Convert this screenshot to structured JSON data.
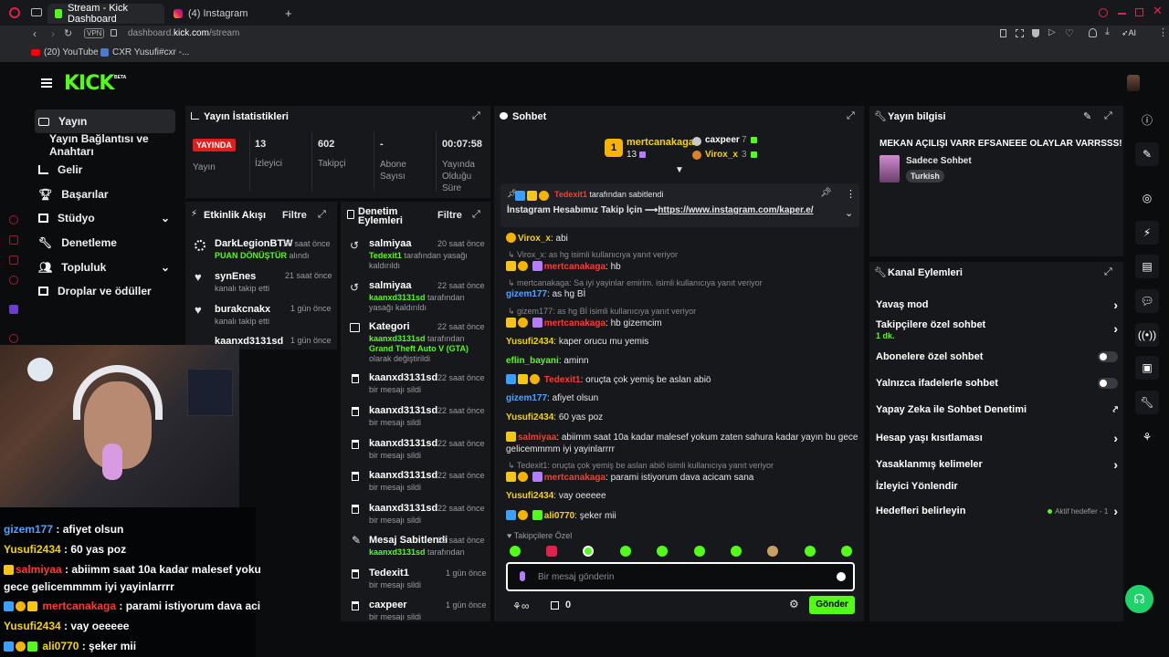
{
  "browser": {
    "tabs": [
      {
        "label": "Stream - Kick Dashboard",
        "active": true
      },
      {
        "label": "(4) Instagram",
        "active": false
      }
    ],
    "new_tab": "+",
    "url_domain_prefix": "dashboard.",
    "url_domain": "kick.com",
    "url_path": "/stream",
    "vpn_label": "VPN",
    "ai_label": "AI",
    "bookmarks": [
      "(20) YouTube",
      "CXR Yusufi#cxr -..."
    ]
  },
  "brand": {
    "logo": "KICK",
    "beta": "BETA",
    "accent": "#53fc18"
  },
  "nav": {
    "items": [
      {
        "label": "Yayın",
        "icon": "video-icon"
      },
      {
        "label": "Yayın Bağlantısı ve Anahtarı",
        "icon": ""
      },
      {
        "label": "Gelir",
        "icon": "chart-icon"
      },
      {
        "label": "Başarılar",
        "icon": "trophy-icon"
      },
      {
        "label": "Stüdyo",
        "icon": "studio-icon"
      },
      {
        "label": "Denetleme",
        "icon": "wrench-icon"
      },
      {
        "label": "Topluluk",
        "icon": "people-icon"
      },
      {
        "label": "Droplar ve ödüller",
        "icon": "gift-icon"
      }
    ]
  },
  "stats": {
    "title": "Yayın İstatistikleri",
    "live_badge": "YAYINDA",
    "live_label": "Yayın",
    "viewers_value": "13",
    "viewers_label": "İzleyici",
    "followers_value": "602",
    "followers_label": "Takipçi",
    "subs_value": "-",
    "subs_label": "Abone Sayısı",
    "uptime_value": "00:07:58",
    "uptime_label": "Yayında Olduğu Süre"
  },
  "activity": {
    "title": "Etkinlik Akışı",
    "filter": "Filtre",
    "items": [
      {
        "name": "DarkLegionBTW",
        "time": "20 saat önce",
        "sub": "PUAN DÖNÜŞTÜR",
        "sub2": " alındı"
      },
      {
        "name": "synEnes",
        "time": "21 saat önce",
        "sub": "kanalı takip etti",
        "sub2": ""
      },
      {
        "name": "burakcnakx",
        "time": "1 gün önce",
        "sub": "kanalı takip etti",
        "sub2": ""
      },
      {
        "name": "kaanxd3131sd",
        "time": "1 gün önce",
        "sub": "kanalı takip etti",
        "sub2": ""
      }
    ]
  },
  "modlog": {
    "title_line1": "Denetim",
    "title_line2": "Eylemleri",
    "filter": "Filtre",
    "items": [
      {
        "name": "salmiyaa",
        "time": "20 saat önce",
        "who": "Tedexit1",
        "text": " tarafından yasağı kaldırıldı"
      },
      {
        "name": "salmiyaa",
        "time": "22 saat önce",
        "who": "kaanxd3131sd",
        "text": " tarafından yasağı kaldırıldı"
      },
      {
        "name": "Kategori",
        "time": "22 saat önce",
        "who": "kaanxd3131sd",
        "text": " tarafından ",
        "extra": "Grand Theft Auto V (GTA)",
        "text2": " olarak değiştirildi"
      },
      {
        "name": "kaanxd3131sd",
        "time": "22 saat önce",
        "text": "bir mesajı sildi"
      },
      {
        "name": "kaanxd3131sd",
        "time": "22 saat önce",
        "text": "bir mesajı sildi"
      },
      {
        "name": "kaanxd3131sd",
        "time": "22 saat önce",
        "text": "bir mesajı sildi"
      },
      {
        "name": "kaanxd3131sd",
        "time": "22 saat önce",
        "text": "bir mesajı sildi"
      },
      {
        "name": "kaanxd3131sd",
        "time": "22 saat önce",
        "text": "bir mesajı sildi"
      },
      {
        "name": "Mesaj Sabitlendi",
        "time": "22 saat önce",
        "who": "kaanxd3131sd",
        "text": " tarafından"
      },
      {
        "name": "Tedexit1",
        "time": "1 gün önce",
        "text": "bir mesajı sildi"
      },
      {
        "name": "caxpeer",
        "time": "1 gün önce",
        "text": "bir mesajı sildi"
      }
    ]
  },
  "chat": {
    "title": "Sohbet",
    "leaderboard": {
      "first_name": "mertcanakaga",
      "first_value": "13",
      "second_name": "caxpeer",
      "second_value": "7",
      "third_name": "Virox_x",
      "third_value": "3"
    },
    "pinned_by": "Tedexit1",
    "pinned_by_suffix": " tarafından sabitlendi",
    "pinned_text": "İnstagram Hesabımız Takip İçin ⟶",
    "pinned_link": "https://www.instagram.com/kaper.e/",
    "messages": [
      {
        "user": "Virox_x",
        "text": ": abi"
      },
      {
        "reply": "Virox_x: as hg isimli kullanıcıya yanıt veriyor"
      },
      {
        "user": "mertcanakaga",
        "text": ": hb"
      },
      {
        "reply": "mertcanakaga: Sa iyi yayinlar emirim. isimli kullanıcıya yanıt veriyor"
      },
      {
        "user": "gizem177",
        "text": ": as hg Bİ"
      },
      {
        "reply": "gizem177: as hg Bİ isimli kullanıcıya yanıt veriyor"
      },
      {
        "user": "mertcanakaga",
        "text": ": hb gizemcim"
      },
      {
        "user": "Yusufi2434",
        "text": ": kaper orucu mu yemis"
      },
      {
        "user": "eflin_bayani",
        "text": ": aminn"
      },
      {
        "user": "Tedexit1",
        "text": ": oruçta çok yemiş be aslan abiö"
      },
      {
        "user": "gizem177",
        "text": ": afiyet olsun"
      },
      {
        "user": "Yusufi2434",
        "text": ": 60 yas poz"
      },
      {
        "user": "salmiyaa",
        "text": ": abiimm saat 10a kadar malesef yokum zaten sahura kadar yayın bu gece"
      },
      {
        "cont": "gelicemmmm iyi yayinlarrrr"
      },
      {
        "reply": "Tedexit1: oruçta çok yemiş be aslan abiö isimli kullanıcıya yanıt veriyor"
      },
      {
        "user": "mertcanakaga",
        "text": ": parami istiyorum dava acicam sana"
      },
      {
        "user": "Yusufi2434",
        "text": ": vay oeeeee"
      },
      {
        "user": "ali0770",
        "text": ": şeker mii"
      }
    ],
    "followers_only": "Takipçilere Özel",
    "input_placeholder": "Bir mesaj gönderin",
    "infinity": "∞",
    "points": "0",
    "send": "Gönder"
  },
  "stream_info": {
    "title": "Yayın bilgisi",
    "stream_title": "MEKAN AÇILIŞI VARR EFSANEEE OLAYLAR VARRSSS!",
    "category": "Sadece Sohbet",
    "tag": "Turkish"
  },
  "channel_actions": {
    "title": "Kanal Eylemleri",
    "rows": [
      {
        "label": "Yavaş mod",
        "control": "chevron"
      },
      {
        "label": "Takipçilere özel sohbet",
        "sub": "1 dk.",
        "control": "chevron"
      },
      {
        "label": "Abonelere özel sohbet",
        "control": "toggle"
      },
      {
        "label": "Yalnızca ifadelerle sohbet",
        "control": "toggle"
      },
      {
        "label": "Yapay Zeka ile Sohbet Denetimi",
        "control": "external"
      },
      {
        "label": "Hesap yaşı kısıtlaması",
        "control": "chevron"
      },
      {
        "label": "Yasaklanmış kelimeler",
        "control": "chevron"
      },
      {
        "label": "İzleyici Yönlendir",
        "control": "none"
      },
      {
        "label": "Hedefleri belirleyin",
        "control": "chevron",
        "status": "Aktif hedefler - 1"
      }
    ]
  },
  "webcam_chat": [
    {
      "user": "gizem177",
      "text": " : afiyet olsun"
    },
    {
      "user": "Yusufi2434",
      "text": " : 60 yas poz"
    },
    {
      "user": "salmiyaa",
      "text": " : abiimm saat 10a kadar malesef yoku"
    },
    {
      "user": "",
      "text": "gece gelicemmmm iyi yayinlarrrr"
    },
    {
      "user": "mertcanakaga",
      "text": " : parami istiyorum dava aci"
    },
    {
      "user": "Yusufi2434",
      "text": " : vay oeeeee"
    },
    {
      "user": "ali0770",
      "text": " : şeker mii"
    }
  ]
}
